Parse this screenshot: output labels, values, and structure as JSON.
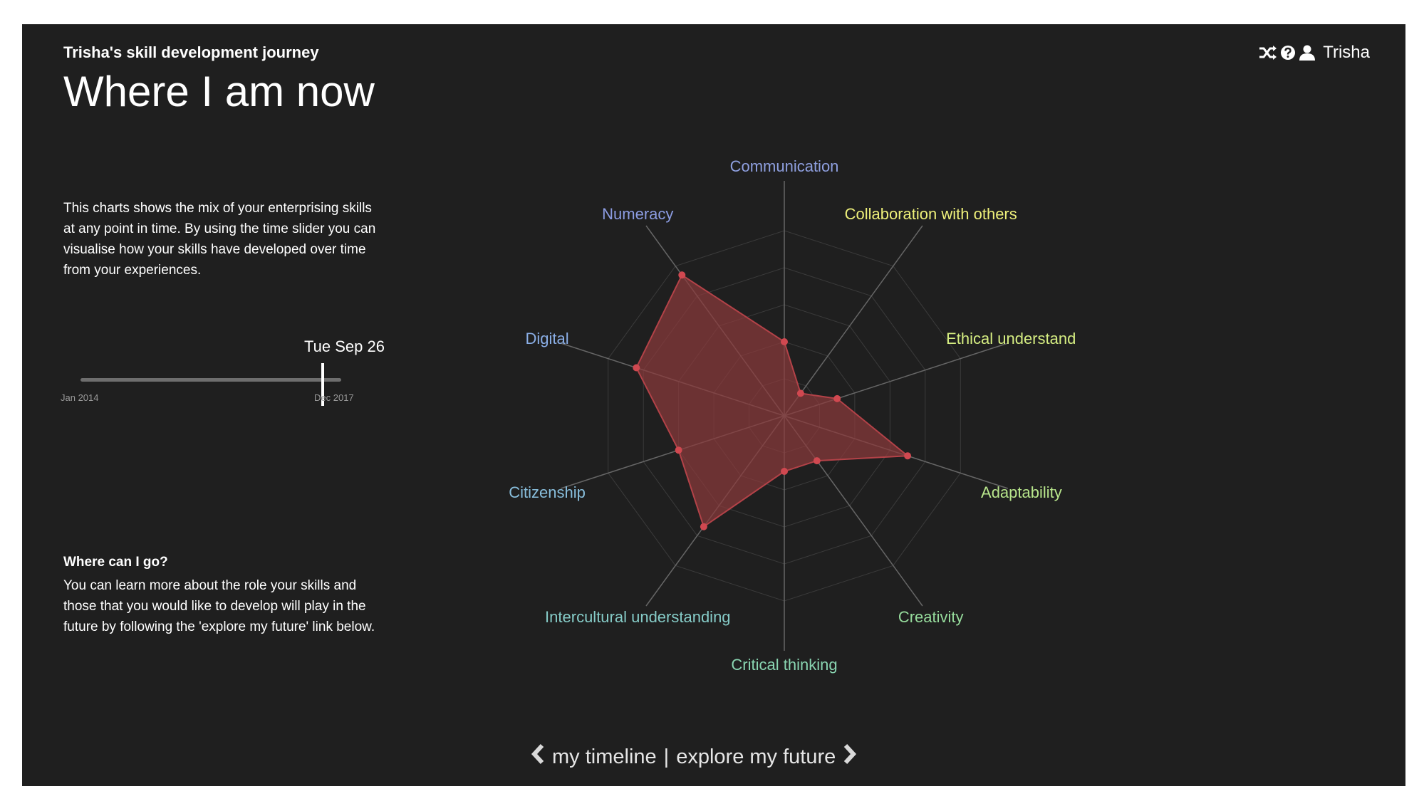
{
  "header": {
    "app_title": "Trisha's skill development journey",
    "page_title": "Where I am now",
    "user_name": "Trisha",
    "icons": [
      "shuffle-icon",
      "help-icon",
      "user-icon"
    ]
  },
  "intro": {
    "text": "This charts shows the mix of your enterprising skills at any point in time. By using the time slider you can visualise how your skills have developed over time from your experiences."
  },
  "time_slider": {
    "current_date": "Tue Sep 26",
    "start_label": "Jan 2014",
    "end_label": "Dec 2017",
    "position_fraction": 0.93
  },
  "where_can_i_go": {
    "title": "Where can I go?",
    "text": "You can learn more about the role your skills and those that you would like to develop will play in the future by following the 'explore my future' link below."
  },
  "footer_nav": {
    "prev_label": "my timeline",
    "separator": "|",
    "next_label": "explore my future"
  },
  "colors": {
    "background": "#1f1f1f",
    "polygon_fill": "#8b3a3c",
    "polygon_stroke": "#b34248",
    "point": "#d04850"
  },
  "chart_data": {
    "type": "radar",
    "axes": [
      {
        "label": "Communication",
        "value": 0.4,
        "color": "#8fa0e0"
      },
      {
        "label": "Collaboration with others",
        "value": 0.15,
        "color": "#eef07a"
      },
      {
        "label": "Ethical understanding",
        "value": 0.3,
        "color": "#d6ee82"
      },
      {
        "label": "Adaptability",
        "value": 0.7,
        "color": "#b8e68c"
      },
      {
        "label": "Creativity",
        "value": 0.3,
        "color": "#96dc9c"
      },
      {
        "label": "Critical thinking",
        "value": 0.3,
        "color": "#8ad6b2"
      },
      {
        "label": "Intercultural understanding",
        "value": 0.74,
        "color": "#86ccc8"
      },
      {
        "label": "Citizenship",
        "value": 0.6,
        "color": "#88bedc"
      },
      {
        "label": "Digital",
        "value": 0.84,
        "color": "#8aaee6"
      },
      {
        "label": "Numeracy",
        "value": 0.94,
        "color": "#8c9ce2"
      }
    ],
    "levels": 5,
    "range": [
      0,
      1
    ],
    "legend": "none"
  }
}
